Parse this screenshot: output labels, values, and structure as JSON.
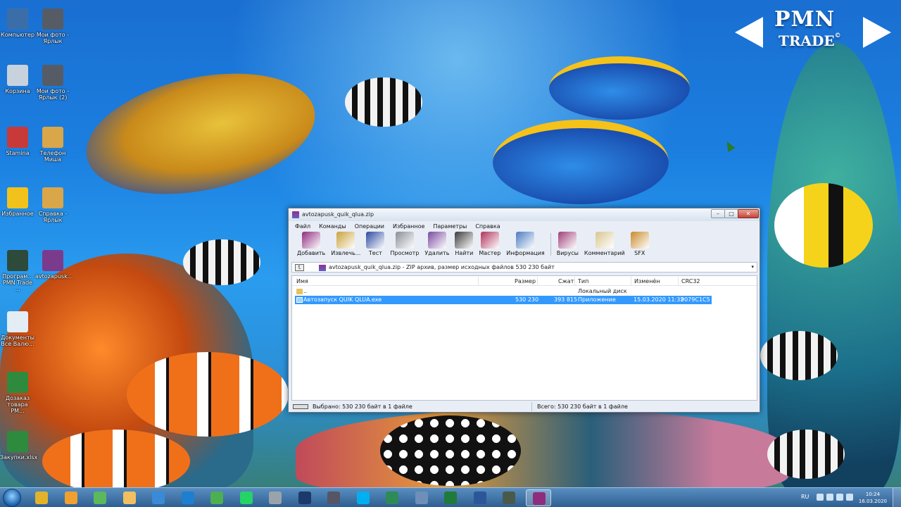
{
  "desktop": {
    "icons": [
      {
        "label": "Компьютер",
        "color": "#3b6ea8"
      },
      {
        "label": "Мои фото - Ярлык",
        "color": "#555c66"
      },
      {
        "label": "Корзина",
        "color": "#c8d2dc"
      },
      {
        "label": "Мои фото - Ярлык (2)",
        "color": "#555c66"
      },
      {
        "label": "Stamina",
        "color": "#c83a3a"
      },
      {
        "label": "Телефон Миша",
        "color": "#d9a64a"
      },
      {
        "label": "Избранное",
        "color": "#f2c21c"
      },
      {
        "label": "Справка - Ярлык",
        "color": "#d9a64a"
      },
      {
        "label": "Програм... PMN Trade ...",
        "color": "#2d4a3a"
      },
      {
        "label": "avtozapusk...",
        "color": "#7b3b8c"
      },
      {
        "label": "Документы Все Валю...",
        "color": "#e4ecf4"
      },
      {
        "label": "Дозаказ товара РМ...",
        "color": "#2e8b3e"
      },
      {
        "label": "Закупки.xlsx",
        "color": "#2e8b3e"
      }
    ]
  },
  "logo": {
    "line1": "PMN",
    "line2": "TRADE",
    "mark": "©"
  },
  "window": {
    "title": "avtozapusk_quik_qlua.zip",
    "controls": {
      "min": "–",
      "max": "□",
      "close": "✕"
    },
    "menu": [
      "Файл",
      "Команды",
      "Операции",
      "Избранное",
      "Параметры",
      "Справка"
    ],
    "toolbar": [
      {
        "label": "Добавить",
        "icon": "add-icon",
        "color": "#8e2c7e"
      },
      {
        "label": "Извлечь...",
        "icon": "extract-icon",
        "color": "#c9a23a"
      },
      {
        "label": "Тест",
        "icon": "test-icon",
        "color": "#2b4aa0"
      },
      {
        "label": "Просмотр",
        "icon": "view-icon",
        "color": "#8a8f96"
      },
      {
        "label": "Удалить",
        "icon": "delete-icon",
        "color": "#7a4aa0"
      },
      {
        "label": "Найти",
        "icon": "find-icon",
        "color": "#3b3b3b"
      },
      {
        "label": "Мастер",
        "icon": "wizard-icon",
        "color": "#b0325a"
      },
      {
        "label": "Информация",
        "icon": "info-icon",
        "color": "#4b7bc0"
      },
      {
        "label": "Вирусы",
        "icon": "virus-icon",
        "color": "#a0407a"
      },
      {
        "label": "Комментарий",
        "icon": "comment-icon",
        "color": "#d8c690"
      },
      {
        "label": "SFX",
        "icon": "sfx-icon",
        "color": "#c98a2a"
      }
    ],
    "address": {
      "path": "avtozapusk_quik_qlua.zip - ZIP архив, размер исходных файлов 530 230 байт",
      "up": "⮤",
      "dropdown": "▾"
    },
    "columns": {
      "name": "Имя",
      "size": "Размер",
      "packed": "Сжат",
      "type": "Тип",
      "modified": "Изменён",
      "crc": "CRC32"
    },
    "rows": [
      {
        "name": "..",
        "size": "",
        "packed": "",
        "type": "Локальный диск",
        "modified": "",
        "crc": ""
      },
      {
        "name": "Автозапуск QUIK QLUA.exe",
        "size": "530 230",
        "packed": "393 815",
        "type": "Приложение",
        "modified": "15.03.2020 11:32",
        "crc": "9079C1C5"
      }
    ],
    "status": {
      "left": "Выбрано: 530 230 байт в 1 файле",
      "right": "Всего: 530 230 байт в 1 файле"
    }
  },
  "taskbar": {
    "items": [
      {
        "icon": "chrome-icon",
        "color": "#e2b32a"
      },
      {
        "icon": "outlook-icon",
        "color": "#f0a030"
      },
      {
        "icon": "utorrent-icon",
        "color": "#5cb85c"
      },
      {
        "icon": "folder-icon",
        "color": "#f0c060"
      },
      {
        "icon": "media-player-icon",
        "color": "#3b8ad8"
      },
      {
        "icon": "ie-icon",
        "color": "#1e7fd0"
      },
      {
        "icon": "arrow-app-icon",
        "color": "#4caf50"
      },
      {
        "icon": "whatsapp-icon",
        "color": "#25d366"
      },
      {
        "icon": "calculator-icon",
        "color": "#9aa3ac"
      },
      {
        "icon": "photoshop-icon",
        "color": "#1b3a6b"
      },
      {
        "icon": "scanner-icon",
        "color": "#556"
      },
      {
        "icon": "skype-icon",
        "color": "#00aff0"
      },
      {
        "icon": "app-green-icon",
        "color": "#2e8b57"
      },
      {
        "icon": "network-icon",
        "color": "#6f8fb8"
      },
      {
        "icon": "excel-icon",
        "color": "#1e7b3a"
      },
      {
        "icon": "word-icon",
        "color": "#2b579a"
      },
      {
        "icon": "terminal-icon",
        "color": "#4a5a4a"
      },
      {
        "icon": "winrar-icon",
        "color": "#8e2c7e"
      }
    ],
    "lang": "RU",
    "time": "10:24",
    "date": "16.03.2020"
  }
}
